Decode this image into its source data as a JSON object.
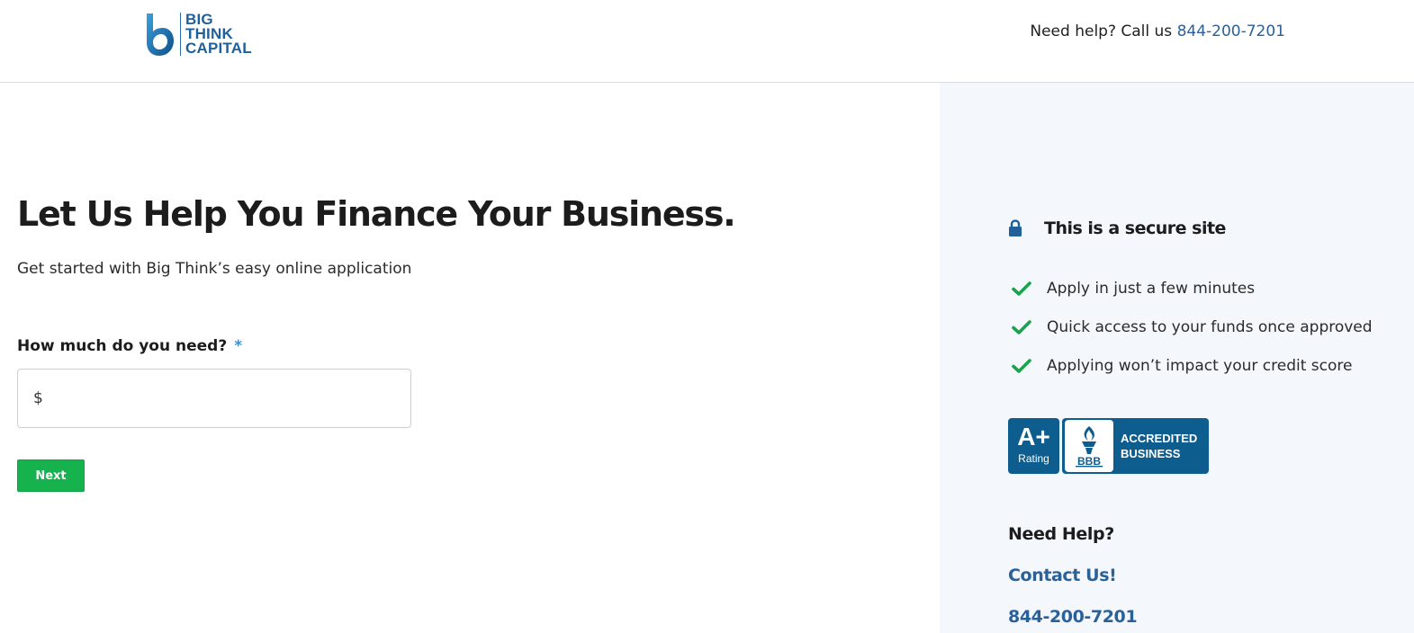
{
  "header": {
    "logo": {
      "lines": [
        "BIG",
        "THINK",
        "CAPITAL"
      ],
      "icon": "b-swoosh-logo-icon"
    },
    "help_prefix": "Need help?  Call us",
    "phone": "844-200-7201"
  },
  "main": {
    "headline": "Let Us Help You Finance Your Business.",
    "subline": "Get started with Big Think’s easy online application",
    "amount_field": {
      "label": "How much do you need?",
      "required_mark": "*",
      "prefix": "$",
      "value": ""
    },
    "next_button": "Next"
  },
  "sidebar": {
    "secure_icon": "lock-icon",
    "secure_text": "This is a secure site",
    "benefits": [
      {
        "icon": "checkmark-icon",
        "text": "Apply in just a few minutes"
      },
      {
        "icon": "checkmark-icon",
        "text": "Quick access to your funds once approved"
      },
      {
        "icon": "checkmark-icon",
        "text": "Applying won’t impact your credit score"
      }
    ],
    "bbb_badge": {
      "grade": "A+",
      "grade_label": "Rating",
      "seal_text": "BBB",
      "accredited_lines": [
        "ACCREDITED",
        "BUSINESS"
      ]
    },
    "need_help_heading": "Need Help?",
    "contact_link": "Contact Us!",
    "phone": "844-200-7201"
  },
  "colors": {
    "brand_blue": "#1f5f9a",
    "link_blue": "#2a6199",
    "button_green": "#15b24d",
    "check_green": "#1aa34a",
    "sidebar_bg": "#f4f8fc",
    "bbb_blue": "#0e5d8f",
    "required_blue": "#3d8fcf"
  }
}
